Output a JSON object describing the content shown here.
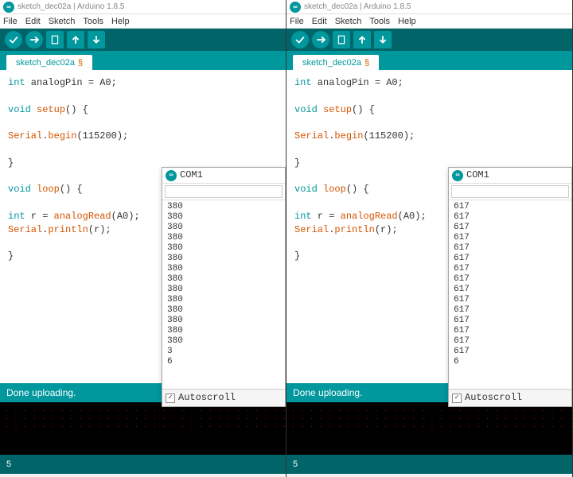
{
  "app": {
    "title_prefix": "sketch_dec02a",
    "title_suffix": "Arduino 1.8.5"
  },
  "menu": {
    "file": "File",
    "edit": "Edit",
    "sketch": "Sketch",
    "tools": "Tools",
    "help": "Help"
  },
  "toolbar": {
    "verify": "Verify",
    "upload": "Upload",
    "new": "New",
    "open": "Open",
    "save": "Save"
  },
  "tab": {
    "name": "sketch_dec02a",
    "modified_marker": "§"
  },
  "code": {
    "l1_a": "int",
    "l1_b": " analogPin = A0;",
    "l2_a": "void",
    "l2_b": " setup",
    "l2_c": "() {",
    "l3_a": "  Serial",
    "l3_b": ".",
    "l3_c": "begin",
    "l3_d": "(115200);",
    "l4": "}",
    "l5_a": "void",
    "l5_b": " loop",
    "l5_c": "() {",
    "l6_a": "  int",
    "l6_b": " r = ",
    "l6_c": "analogRead",
    "l6_d": "(A0);",
    "l7_a": "  Serial",
    "l7_b": ".",
    "l7_c": "println",
    "l7_d": "(r);",
    "l8": "}"
  },
  "status": {
    "msg": "Done uploading."
  },
  "footer": {
    "line": "5"
  },
  "serial": {
    "title": "COM1",
    "autoscroll_label": "Autoscroll",
    "autoscroll_checked": "✓"
  },
  "paneA": {
    "readings": [
      "380",
      "380",
      "380",
      "380",
      "380",
      "380",
      "380",
      "380",
      "380",
      "380",
      "380",
      "380",
      "380",
      "380",
      "3",
      "6"
    ]
  },
  "paneB": {
    "readings": [
      "617",
      "617",
      "617",
      "617",
      "617",
      "617",
      "617",
      "617",
      "617",
      "617",
      "617",
      "617",
      "617",
      "617",
      "617",
      "6"
    ]
  },
  "colors": {
    "teal_dark": "#006468",
    "teal": "#00979d",
    "orange": "#d35400"
  }
}
